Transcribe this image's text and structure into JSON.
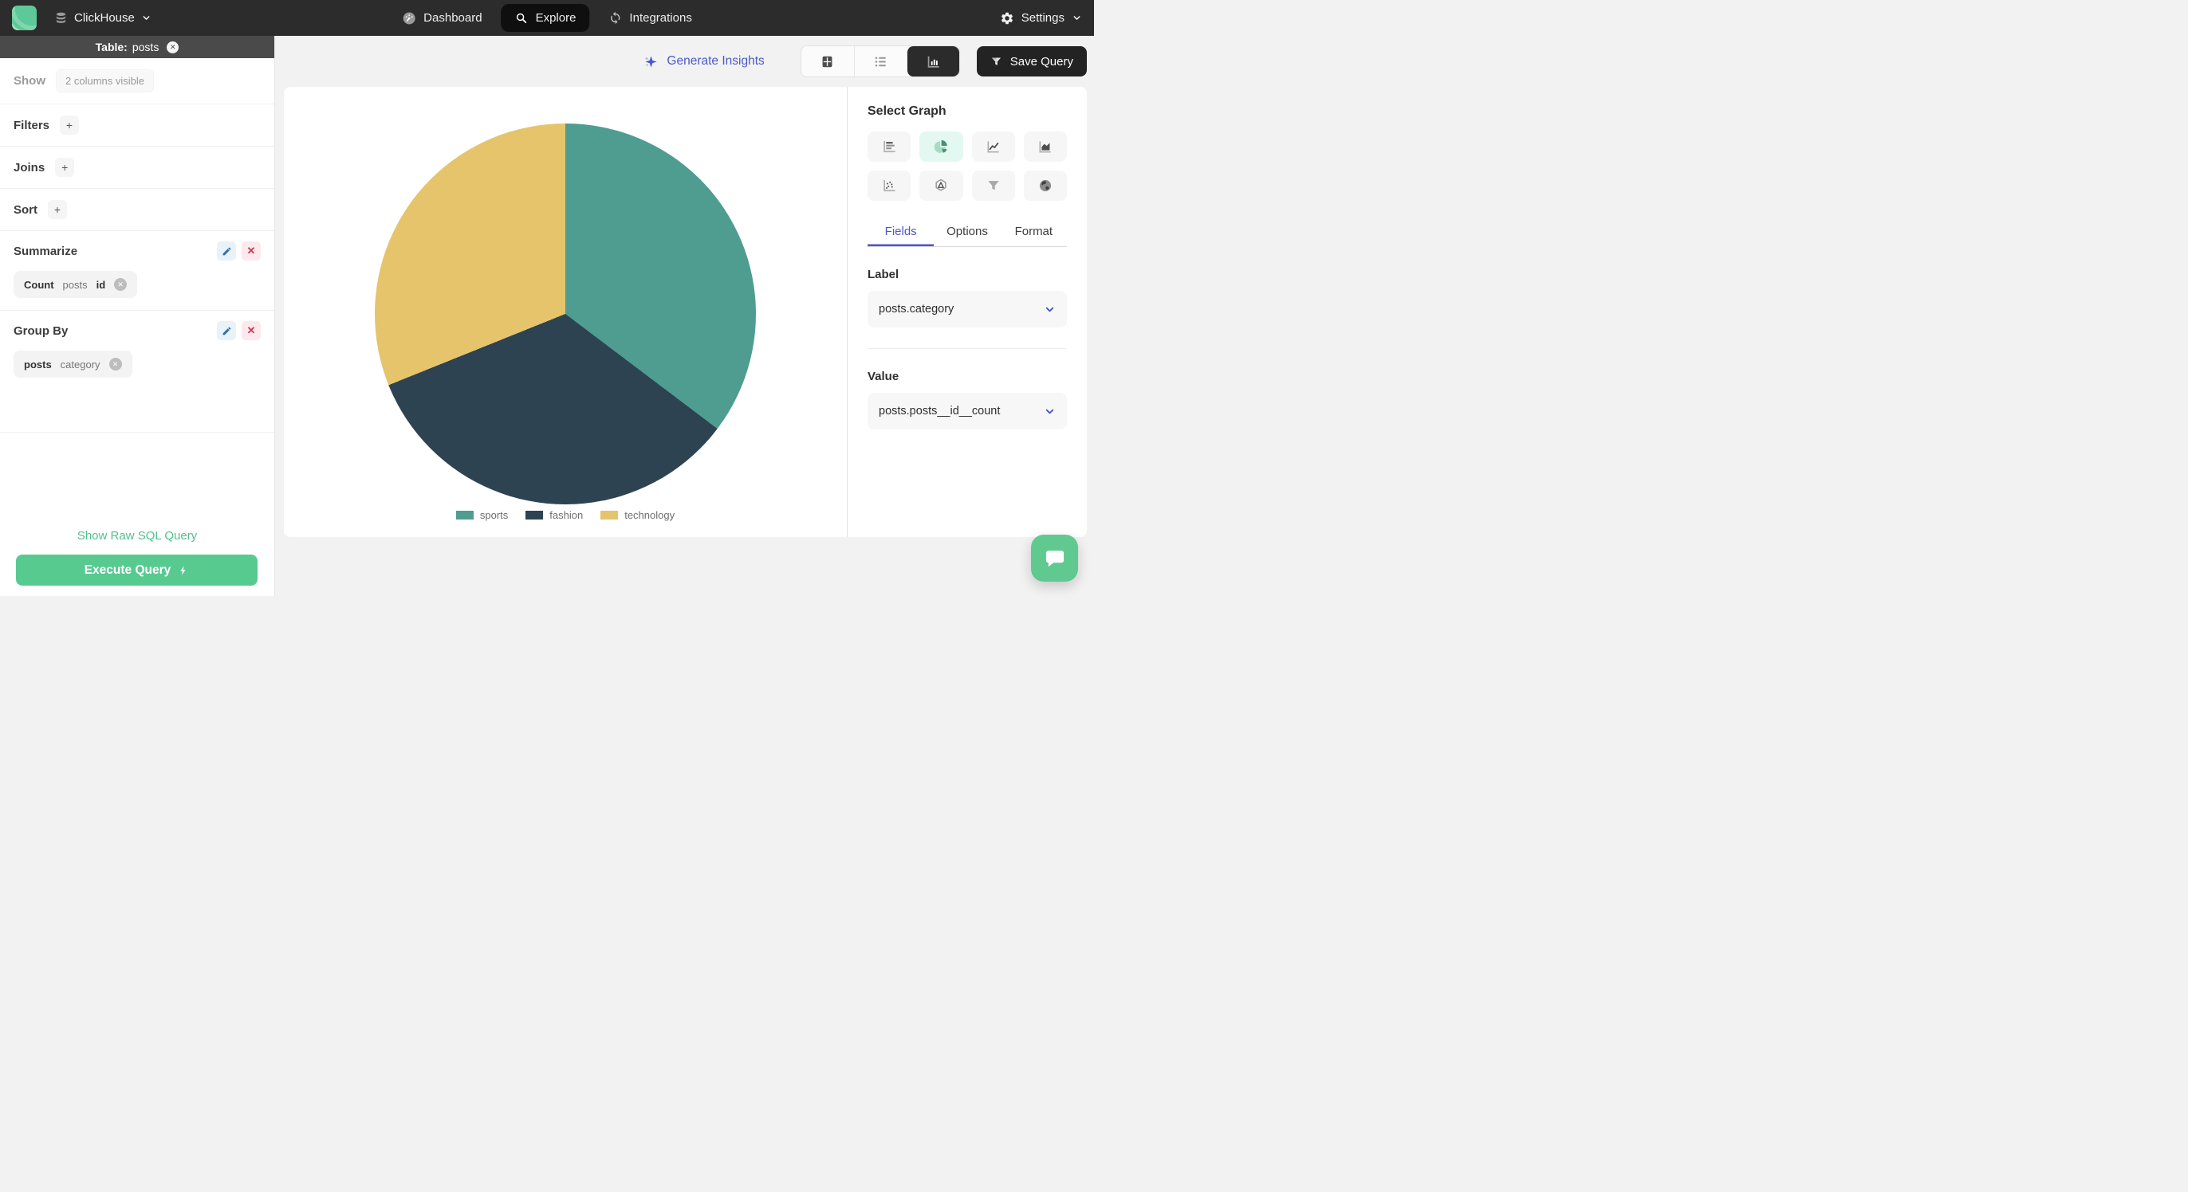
{
  "navbar": {
    "brand": "ClickHouse",
    "nav_items": [
      {
        "label": "Dashboard",
        "icon": "gauge-icon",
        "active": false
      },
      {
        "label": "Explore",
        "icon": "search-icon",
        "active": true
      },
      {
        "label": "Integrations",
        "icon": "sync-icon",
        "active": false
      }
    ],
    "settings_label": "Settings"
  },
  "sidebar": {
    "table_header": {
      "prefix": "Table:",
      "table_name": "posts"
    },
    "show_row": {
      "label": "Show",
      "chip": "2 columns visible"
    },
    "sections": [
      {
        "label": "Filters",
        "add_button": "+"
      },
      {
        "label": "Joins",
        "add_button": "+"
      },
      {
        "label": "Sort",
        "add_button": "+"
      }
    ],
    "summarize": {
      "label": "Summarize",
      "chip": {
        "aggregate": "Count",
        "table": "posts",
        "column": "id"
      }
    },
    "group_by": {
      "label": "Group By",
      "chip": {
        "table": "posts",
        "column": "category"
      }
    },
    "raw_sql_link": "Show Raw SQL Query",
    "execute_button": "Execute Query"
  },
  "toolbar": {
    "generate_insights_label": "Generate Insights",
    "save_query_label": "Save Query",
    "view_toggles": [
      "table-view",
      "list-view",
      "chart-view"
    ],
    "active_view": "chart-view"
  },
  "chart_data": {
    "type": "pie",
    "categories": [
      "sports",
      "fashion",
      "technology"
    ],
    "values": [
      35.3,
      33.6,
      31.1
    ],
    "units": "percent of total, estimated from slice angles (numeric counts not shown on screen)",
    "colors": [
      "#4e9d90",
      "#2d4351",
      "#e5c46b"
    ],
    "title": "",
    "legend_position": "bottom",
    "start_angle_deg": 0,
    "direction": "clockwise"
  },
  "right_panel": {
    "select_graph_label": "Select Graph",
    "graph_types": [
      "bar",
      "pie",
      "line",
      "area",
      "scatter",
      "radar",
      "funnel",
      "geo"
    ],
    "active_graph": "pie",
    "tabs": [
      {
        "label": "Fields",
        "active": true
      },
      {
        "label": "Options",
        "active": false
      },
      {
        "label": "Format",
        "active": false
      }
    ],
    "label_field": {
      "heading": "Label",
      "value": "posts.category"
    },
    "value_field": {
      "heading": "Value",
      "value": "posts.posts__id__count"
    }
  },
  "icons": {
    "brand": "database-icon",
    "dashboard": "gauge-icon",
    "explore": "search-icon",
    "integrations": "sync-icon",
    "settings": "gear-icon",
    "generate_insights": "sparkle-icon",
    "save_query": "funnel-icon",
    "execute": "lightning-icon",
    "chat": "chat-bubble-icon"
  },
  "colors": {
    "navbar_bg": "#2c2c2c",
    "table_header_bg": "#4a4a4a",
    "page_bg": "#f2f2f2",
    "accent_green": "#57ca90",
    "accent_indigo": "#4d59c8",
    "edit_blue": "#2f6fa8",
    "danger_red": "#cb3a52",
    "graph_active_bg": "#e3f8f0"
  }
}
